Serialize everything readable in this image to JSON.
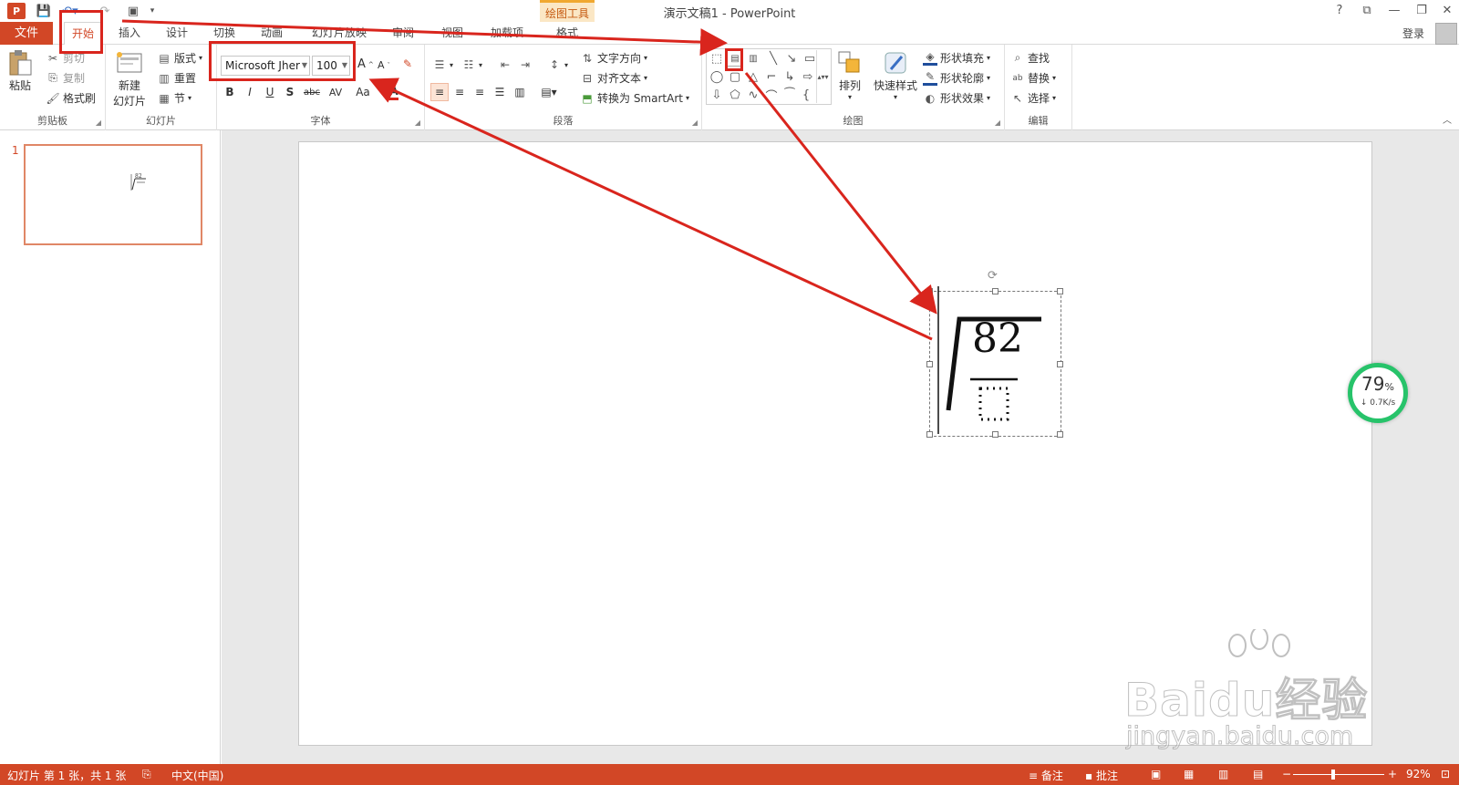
{
  "titlebar": {
    "title": "演示文稿1 - PowerPoint",
    "context_tool": "绘图工具",
    "help": "?",
    "window_controls": [
      "?",
      "⧉",
      "—",
      "❐",
      "✕"
    ]
  },
  "tabs": {
    "file": "文件",
    "items": [
      "开始",
      "插入",
      "设计",
      "切换",
      "动画",
      "幻灯片放映",
      "审阅",
      "视图",
      "加载项",
      "格式"
    ],
    "active": "开始",
    "login": "登录"
  },
  "ribbon": {
    "clipboard": {
      "label": "剪贴板",
      "paste": "粘贴",
      "cut": "剪切",
      "copy": "复制",
      "format_painter": "格式刷"
    },
    "slides": {
      "label": "幻灯片",
      "new_slide": "新建",
      "new_slide2": "幻灯片",
      "layout": "版式",
      "reset": "重置",
      "section": "节"
    },
    "font": {
      "label": "字体",
      "font_name": "Microsoft Jher",
      "font_size": "100",
      "bold": "B",
      "italic": "I",
      "underline": "U",
      "shadow": "S",
      "strike": "abc",
      "spacing": "AV",
      "case": "Aa"
    },
    "paragraph": {
      "label": "段落",
      "text_direction": "文字方向",
      "align_text": "对齐文本",
      "smartart": "转换为 SmartArt"
    },
    "drawing": {
      "label": "绘图",
      "arrange": "排列",
      "quick_styles": "快速样式",
      "shape_fill": "形状填充",
      "shape_outline": "形状轮廓",
      "shape_effects": "形状效果"
    },
    "editing": {
      "label": "编辑",
      "find": "查找",
      "replace": "替换",
      "select": "选择"
    }
  },
  "slide_panel": {
    "slide_number": "1"
  },
  "slide": {
    "radicand": "82"
  },
  "speed_widget": {
    "percent": "79",
    "percent_sign": "%",
    "rate": "↓ 0.7K/s"
  },
  "watermark": {
    "brand": "Baidu经验",
    "url": "jingyan.baidu.com"
  },
  "statusbar": {
    "slide_info": "幻灯片 第 1 张，共 1 张",
    "language": "中文(中国)",
    "notes": "备注",
    "comments": "批注",
    "zoom": "92%"
  },
  "colors": {
    "accent": "#d24726",
    "annotation": "#d9251d",
    "speed_ring": "#27c36a"
  }
}
